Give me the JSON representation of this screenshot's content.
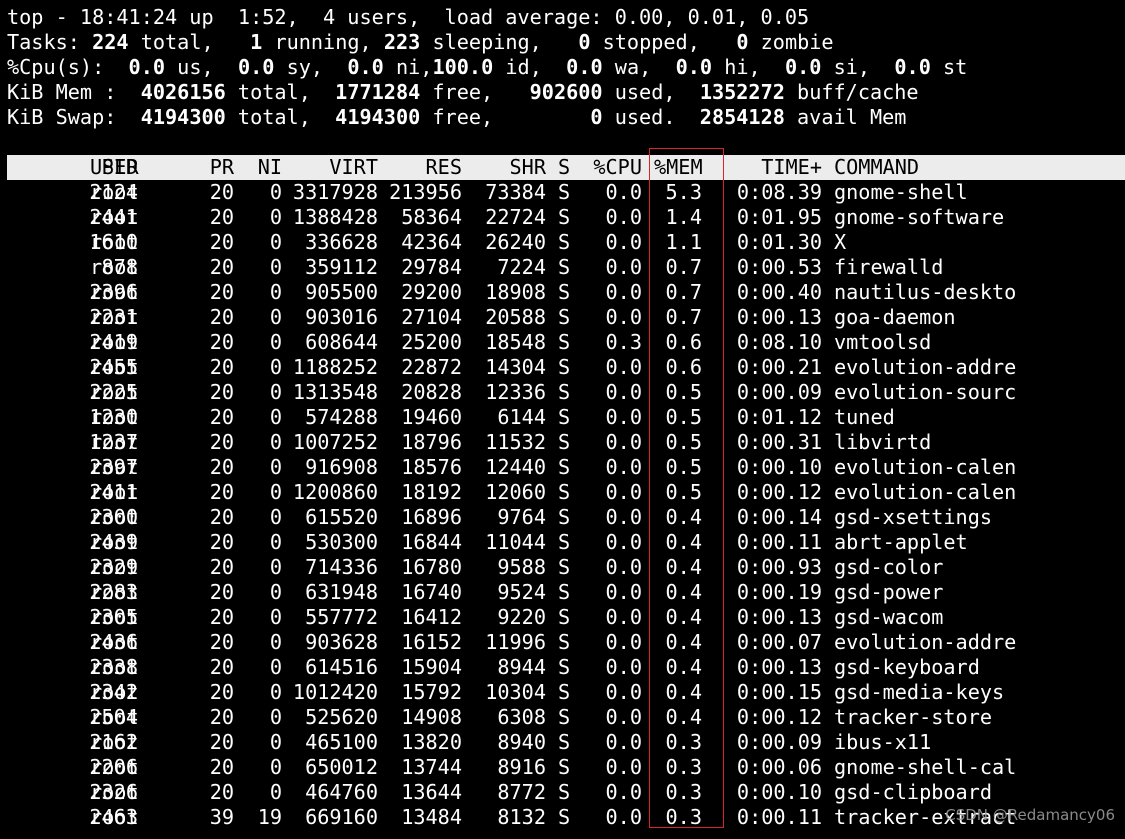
{
  "summary": {
    "top_line": "top - 18:41:24 up  1:52,  4 users,  load average: 0.00, 0.01, 0.05",
    "tasks": {
      "label": "Tasks:",
      "total": "224",
      "total_label": "total,",
      "running": "1",
      "running_label": "running,",
      "sleeping": "223",
      "sleeping_label": "sleeping,",
      "stopped": "0",
      "stopped_label": "stopped,",
      "zombie": "0",
      "zombie_label": "zombie"
    },
    "cpu": {
      "label": "%Cpu(s):",
      "us": "0.0",
      "sy": "0.0",
      "ni": "0.0",
      "id": "100.0",
      "wa": "0.0",
      "hi": "0.0",
      "si": "0.0",
      "st": "0.0"
    },
    "mem": {
      "label": "KiB Mem :",
      "total": "4026156",
      "free": "1771284",
      "used": "902600",
      "buff_cache": "1352272"
    },
    "swap": {
      "label": "KiB Swap:",
      "total": "4194300",
      "free": "4194300",
      "used": "0",
      "avail": "2854128"
    }
  },
  "columns": [
    "PID",
    "USER",
    "PR",
    "NI",
    "VIRT",
    "RES",
    "SHR",
    "S",
    "%CPU",
    "%MEM",
    "TIME+",
    "COMMAND"
  ],
  "processes": [
    {
      "pid": "2124",
      "user": "root",
      "pr": "20",
      "ni": "0",
      "virt": "3317928",
      "res": "213956",
      "shr": "73384",
      "s": "S",
      "cpu": "0.0",
      "mem": "5.3",
      "time": "0:08.39",
      "cmd": "gnome-shell"
    },
    {
      "pid": "2441",
      "user": "root",
      "pr": "20",
      "ni": "0",
      "virt": "1388428",
      "res": "58364",
      "shr": "22724",
      "s": "S",
      "cpu": "0.0",
      "mem": "1.4",
      "time": "0:01.95",
      "cmd": "gnome-software"
    },
    {
      "pid": "1610",
      "user": "root",
      "pr": "20",
      "ni": "0",
      "virt": "336628",
      "res": "42364",
      "shr": "26240",
      "s": "S",
      "cpu": "0.0",
      "mem": "1.1",
      "time": "0:01.30",
      "cmd": "X"
    },
    {
      "pid": "878",
      "user": "root",
      "pr": "20",
      "ni": "0",
      "virt": "359112",
      "res": "29784",
      "shr": "7224",
      "s": "S",
      "cpu": "0.0",
      "mem": "0.7",
      "time": "0:00.53",
      "cmd": "firewalld"
    },
    {
      "pid": "2396",
      "user": "root",
      "pr": "20",
      "ni": "0",
      "virt": "905500",
      "res": "29200",
      "shr": "18908",
      "s": "S",
      "cpu": "0.0",
      "mem": "0.7",
      "time": "0:00.40",
      "cmd": "nautilus-deskto"
    },
    {
      "pid": "2231",
      "user": "root",
      "pr": "20",
      "ni": "0",
      "virt": "903016",
      "res": "27104",
      "shr": "20588",
      "s": "S",
      "cpu": "0.0",
      "mem": "0.7",
      "time": "0:00.13",
      "cmd": "goa-daemon"
    },
    {
      "pid": "2419",
      "user": "root",
      "pr": "20",
      "ni": "0",
      "virt": "608644",
      "res": "25200",
      "shr": "18548",
      "s": "S",
      "cpu": "0.3",
      "mem": "0.6",
      "time": "0:08.10",
      "cmd": "vmtoolsd"
    },
    {
      "pid": "2455",
      "user": "root",
      "pr": "20",
      "ni": "0",
      "virt": "1188252",
      "res": "22872",
      "shr": "14304",
      "s": "S",
      "cpu": "0.0",
      "mem": "0.6",
      "time": "0:00.21",
      "cmd": "evolution-addre"
    },
    {
      "pid": "2225",
      "user": "root",
      "pr": "20",
      "ni": "0",
      "virt": "1313548",
      "res": "20828",
      "shr": "12336",
      "s": "S",
      "cpu": "0.0",
      "mem": "0.5",
      "time": "0:00.09",
      "cmd": "evolution-sourc"
    },
    {
      "pid": "1230",
      "user": "root",
      "pr": "20",
      "ni": "0",
      "virt": "574288",
      "res": "19460",
      "shr": "6144",
      "s": "S",
      "cpu": "0.0",
      "mem": "0.5",
      "time": "0:01.12",
      "cmd": "tuned"
    },
    {
      "pid": "1237",
      "user": "root",
      "pr": "20",
      "ni": "0",
      "virt": "1007252",
      "res": "18796",
      "shr": "11532",
      "s": "S",
      "cpu": "0.0",
      "mem": "0.5",
      "time": "0:00.31",
      "cmd": "libvirtd"
    },
    {
      "pid": "2397",
      "user": "root",
      "pr": "20",
      "ni": "0",
      "virt": "916908",
      "res": "18576",
      "shr": "12440",
      "s": "S",
      "cpu": "0.0",
      "mem": "0.5",
      "time": "0:00.10",
      "cmd": "evolution-calen"
    },
    {
      "pid": "2411",
      "user": "root",
      "pr": "20",
      "ni": "0",
      "virt": "1200860",
      "res": "18192",
      "shr": "12060",
      "s": "S",
      "cpu": "0.0",
      "mem": "0.5",
      "time": "0:00.12",
      "cmd": "evolution-calen"
    },
    {
      "pid": "2300",
      "user": "root",
      "pr": "20",
      "ni": "0",
      "virt": "615520",
      "res": "16896",
      "shr": "9764",
      "s": "S",
      "cpu": "0.0",
      "mem": "0.4",
      "time": "0:00.14",
      "cmd": "gsd-xsettings"
    },
    {
      "pid": "2439",
      "user": "root",
      "pr": "20",
      "ni": "0",
      "virt": "530300",
      "res": "16844",
      "shr": "11044",
      "s": "S",
      "cpu": "0.0",
      "mem": "0.4",
      "time": "0:00.11",
      "cmd": "abrt-applet"
    },
    {
      "pid": "2329",
      "user": "root",
      "pr": "20",
      "ni": "0",
      "virt": "714336",
      "res": "16780",
      "shr": "9588",
      "s": "S",
      "cpu": "0.0",
      "mem": "0.4",
      "time": "0:00.93",
      "cmd": "gsd-color"
    },
    {
      "pid": "2283",
      "user": "root",
      "pr": "20",
      "ni": "0",
      "virt": "631948",
      "res": "16740",
      "shr": "9524",
      "s": "S",
      "cpu": "0.0",
      "mem": "0.4",
      "time": "0:00.19",
      "cmd": "gsd-power"
    },
    {
      "pid": "2305",
      "user": "root",
      "pr": "20",
      "ni": "0",
      "virt": "557772",
      "res": "16412",
      "shr": "9220",
      "s": "S",
      "cpu": "0.0",
      "mem": "0.4",
      "time": "0:00.13",
      "cmd": "gsd-wacom"
    },
    {
      "pid": "2436",
      "user": "root",
      "pr": "20",
      "ni": "0",
      "virt": "903628",
      "res": "16152",
      "shr": "11996",
      "s": "S",
      "cpu": "0.0",
      "mem": "0.4",
      "time": "0:00.07",
      "cmd": "evolution-addre"
    },
    {
      "pid": "2338",
      "user": "root",
      "pr": "20",
      "ni": "0",
      "virt": "614516",
      "res": "15904",
      "shr": "8944",
      "s": "S",
      "cpu": "0.0",
      "mem": "0.4",
      "time": "0:00.13",
      "cmd": "gsd-keyboard"
    },
    {
      "pid": "2342",
      "user": "root",
      "pr": "20",
      "ni": "0",
      "virt": "1012420",
      "res": "15792",
      "shr": "10304",
      "s": "S",
      "cpu": "0.0",
      "mem": "0.4",
      "time": "0:00.15",
      "cmd": "gsd-media-keys"
    },
    {
      "pid": "2504",
      "user": "root",
      "pr": "20",
      "ni": "0",
      "virt": "525620",
      "res": "14908",
      "shr": "6308",
      "s": "S",
      "cpu": "0.0",
      "mem": "0.4",
      "time": "0:00.12",
      "cmd": "tracker-store"
    },
    {
      "pid": "2162",
      "user": "root",
      "pr": "20",
      "ni": "0",
      "virt": "465100",
      "res": "13820",
      "shr": "8940",
      "s": "S",
      "cpu": "0.0",
      "mem": "0.3",
      "time": "0:00.09",
      "cmd": "ibus-x11"
    },
    {
      "pid": "2206",
      "user": "root",
      "pr": "20",
      "ni": "0",
      "virt": "650012",
      "res": "13744",
      "shr": "8916",
      "s": "S",
      "cpu": "0.0",
      "mem": "0.3",
      "time": "0:00.06",
      "cmd": "gnome-shell-cal"
    },
    {
      "pid": "2326",
      "user": "root",
      "pr": "20",
      "ni": "0",
      "virt": "464760",
      "res": "13644",
      "shr": "8772",
      "s": "S",
      "cpu": "0.0",
      "mem": "0.3",
      "time": "0:00.10",
      "cmd": "gsd-clipboard"
    },
    {
      "pid": "2463",
      "user": "root",
      "pr": "39",
      "ni": "19",
      "virt": "669160",
      "res": "13484",
      "shr": "8132",
      "s": "S",
      "cpu": "0.0",
      "mem": "0.3",
      "time": "0:00.11",
      "cmd": "tracker-extract"
    }
  ],
  "highlight_color": "#d9232a",
  "watermark": "CSDN @Redamancy06"
}
